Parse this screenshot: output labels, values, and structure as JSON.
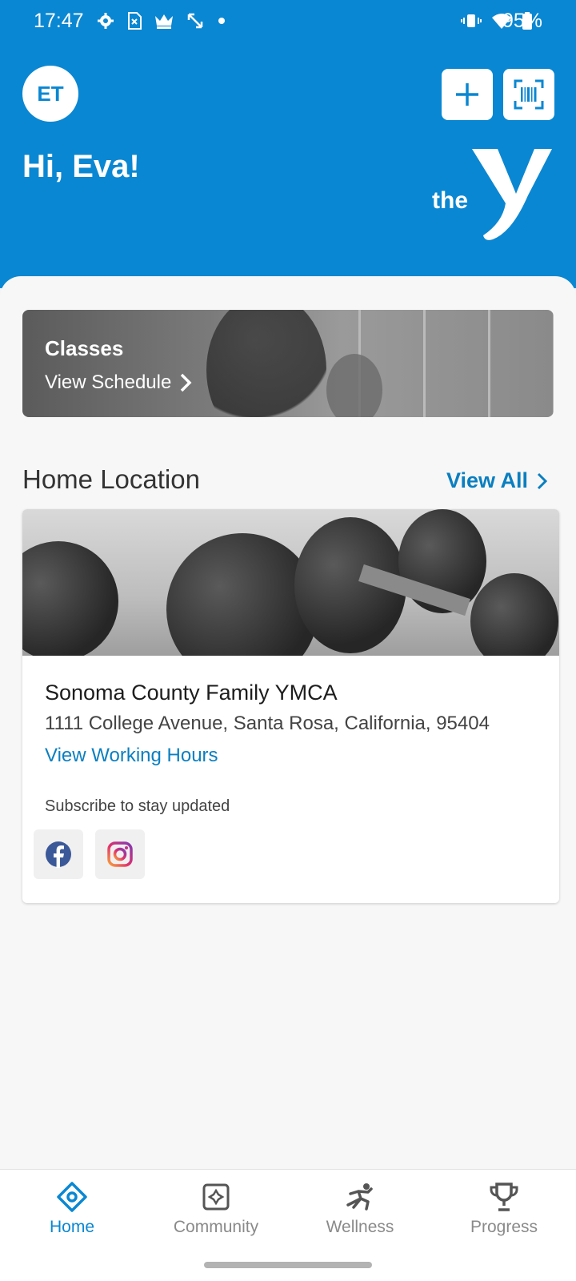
{
  "status_bar": {
    "time": "17:47",
    "battery": "95%",
    "left_icons": [
      "gear-icon",
      "sim-icon",
      "crown-icon",
      "expand-icon",
      "dot-icon"
    ],
    "right_icons": [
      "vibrate-icon",
      "wifi-icon",
      "battery-icon"
    ]
  },
  "header": {
    "avatar_initials": "ET",
    "greeting": "Hi, Eva!",
    "logo_text": "the",
    "logo_subtext": "YMCA",
    "background_color": "#0a87d2"
  },
  "classes": {
    "title": "Classes",
    "link_label": "View Schedule"
  },
  "home_location": {
    "section_title": "Home Location",
    "view_all_label": "View All",
    "name": "Sonoma County Family YMCA",
    "address": "1111 College Avenue, Santa Rosa, California, 95404",
    "hours_link": "View Working Hours",
    "subscribe_text": "Subscribe to stay updated",
    "social": [
      "facebook-icon",
      "instagram-icon"
    ]
  },
  "bottom_nav": {
    "items": [
      {
        "label": "Home",
        "icon": "home-icon",
        "active": true
      },
      {
        "label": "Community",
        "icon": "community-icon",
        "active": false
      },
      {
        "label": "Wellness",
        "icon": "wellness-icon",
        "active": false
      },
      {
        "label": "Progress",
        "icon": "trophy-icon",
        "active": false
      }
    ]
  },
  "colors": {
    "brand_blue": "#0a87d2",
    "link_blue": "#0a7fc0"
  }
}
